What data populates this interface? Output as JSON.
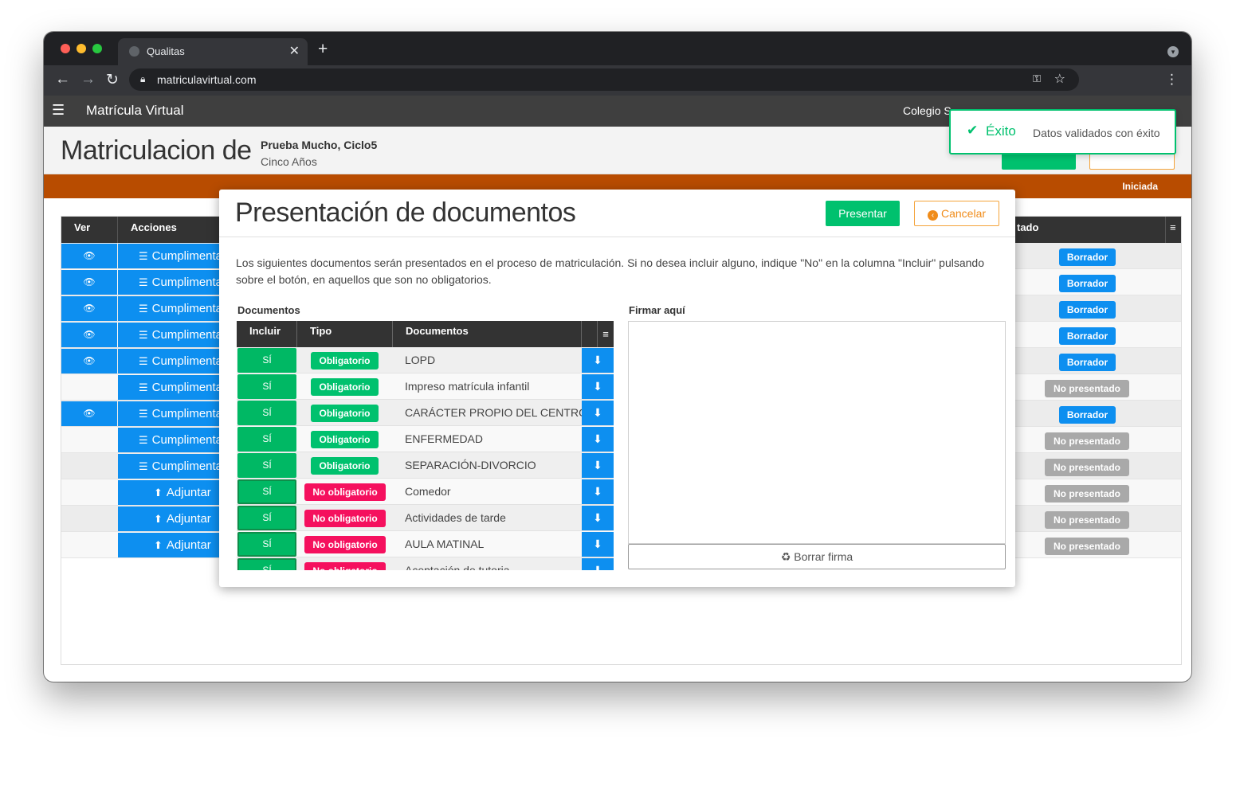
{
  "browser": {
    "tab_title": "Qualitas",
    "url": "matriculavirtual.com"
  },
  "app": {
    "brand": "Matrícula Virtual",
    "school": "Colegio S"
  },
  "page": {
    "title": "Matriculacion de",
    "student_name": "Prueba Mucho, Ciclo5",
    "student_course": "Cinco Años",
    "status": "Iniciada"
  },
  "background_table": {
    "headers": {
      "ver": "Ver",
      "acciones": "Acciones",
      "estado": "tado"
    },
    "rows": [
      {
        "ver": true,
        "action": "Cumplimentar",
        "action_type": "form",
        "state": "Borrador",
        "state_type": "blue"
      },
      {
        "ver": true,
        "action": "Cumplimentar",
        "action_type": "form",
        "state": "Borrador",
        "state_type": "blue"
      },
      {
        "ver": true,
        "action": "Cumplimentar",
        "action_type": "form",
        "state": "Borrador",
        "state_type": "blue"
      },
      {
        "ver": true,
        "action": "Cumplimentar",
        "action_type": "form",
        "state": "Borrador",
        "state_type": "blue"
      },
      {
        "ver": true,
        "action": "Cumplimentar",
        "action_type": "form",
        "state": "Borrador",
        "state_type": "blue"
      },
      {
        "ver": false,
        "action": "Cumplimentar",
        "action_type": "form",
        "state": "No presentado",
        "state_type": "grey"
      },
      {
        "ver": true,
        "action": "Cumplimentar",
        "action_type": "form",
        "state": "Borrador",
        "state_type": "blue"
      },
      {
        "ver": false,
        "action": "Cumplimentar",
        "action_type": "form",
        "state": "No presentado",
        "state_type": "grey"
      },
      {
        "ver": false,
        "action": "Cumplimentar",
        "action_type": "form",
        "state": "No presentado",
        "state_type": "grey"
      },
      {
        "ver": false,
        "action": "Adjuntar",
        "action_type": "upload",
        "state": "No presentado",
        "state_type": "grey"
      },
      {
        "ver": false,
        "action": "Adjuntar",
        "action_type": "upload",
        "state": "No presentado",
        "state_type": "grey"
      },
      {
        "ver": false,
        "action": "Adjuntar",
        "action_type": "upload",
        "state": "No presentado",
        "state_type": "grey"
      }
    ]
  },
  "modal": {
    "title": "Presentación de documentos",
    "presentar_label": "Presentar",
    "cancelar_label": "Cancelar",
    "intro": "Los siguientes documentos serán presentados en el proceso de matriculación. Si no desea incluir alguno, indique \"No\" en la columna \"Incluir\" pulsando sobre el botón, en aquellos que son no obligatorios.",
    "docs_label": "Documentos",
    "sign_label": "Firmar aquí",
    "clear_sign_label": "Borrar firma",
    "docs_headers": {
      "incluir": "Incluir",
      "tipo": "Tipo",
      "documentos": "Documentos"
    },
    "documents": [
      {
        "incluir": "SÍ",
        "tipo": "Obligatorio",
        "tipo_kind": "ob",
        "name": "LOPD"
      },
      {
        "incluir": "SÍ",
        "tipo": "Obligatorio",
        "tipo_kind": "ob",
        "name": "Impreso matrícula infantil"
      },
      {
        "incluir": "SÍ",
        "tipo": "Obligatorio",
        "tipo_kind": "ob",
        "name": "CARÁCTER PROPIO DEL CENTRO"
      },
      {
        "incluir": "SÍ",
        "tipo": "Obligatorio",
        "tipo_kind": "ob",
        "name": "ENFERMEDAD"
      },
      {
        "incluir": "SÍ",
        "tipo": "Obligatorio",
        "tipo_kind": "ob",
        "name": "SEPARACIÓN-DIVORCIO"
      },
      {
        "incluir": "SÍ",
        "tipo": "No obligatorio",
        "tipo_kind": "no",
        "name": "Comedor"
      },
      {
        "incluir": "SÍ",
        "tipo": "No obligatorio",
        "tipo_kind": "no",
        "name": "Actividades de tarde"
      },
      {
        "incluir": "SÍ",
        "tipo": "No obligatorio",
        "tipo_kind": "no",
        "name": "AULA MATINAL"
      },
      {
        "incluir": "SÍ",
        "tipo": "No obligatorio",
        "tipo_kind": "no",
        "name": "Aceptación de tutoria"
      }
    ]
  },
  "toast": {
    "title": "Éxito",
    "message": "Datos validados con éxito"
  },
  "colors": {
    "accent_green": "#00c16e",
    "primary_blue": "#0d8ff0",
    "status_orange": "#b84c00",
    "badge_pink": "#f5105e",
    "badge_grey": "#a9a9a9"
  }
}
